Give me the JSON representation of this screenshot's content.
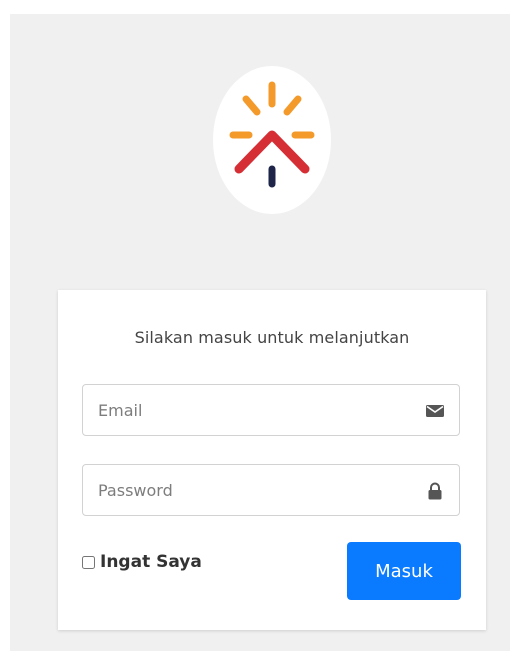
{
  "logo": {
    "name": "sun-house-logo",
    "colors": {
      "rays": "#f39a2b",
      "roof": "#d62e35",
      "door": "#1e2548"
    }
  },
  "login": {
    "subtitle": "Silakan masuk untuk melanjutkan",
    "email": {
      "placeholder": "Email",
      "value": "",
      "icon": "envelope-icon"
    },
    "password": {
      "placeholder": "Password",
      "value": "",
      "icon": "lock-icon"
    },
    "remember_label": "Ingat Saya",
    "remember_checked": false,
    "submit_label": "Masuk"
  },
  "colors": {
    "primary": "#0a7bff",
    "background": "#f0f0f0"
  }
}
